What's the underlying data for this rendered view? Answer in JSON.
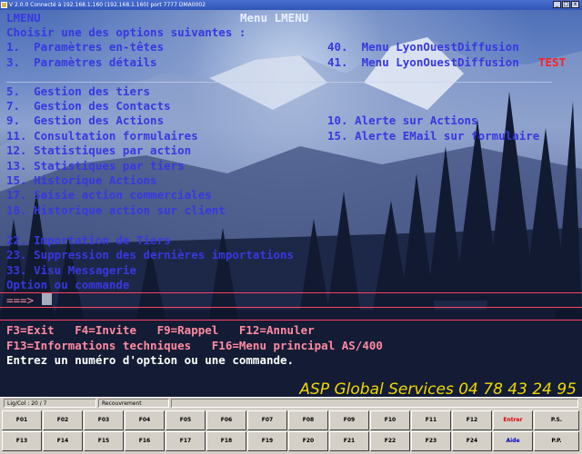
{
  "titlebar": {
    "text": "V 2.0.0 Connecté à 192.168.1.160 (192.168.1.160) port 7777  DMA0002",
    "buttons": [
      "_",
      "□",
      "x"
    ]
  },
  "terminal": {
    "screen_id": "LMENU",
    "title": "Menu LMENU",
    "prompt": "Choisir une des options suivantes :",
    "options_left": [
      "1.  Paramètres en-têtes",
      "3.  Paramètres détails",
      "5.  Gestion des tiers",
      "7.  Gestion des Contacts",
      "9.  Gestion des Actions",
      "11. Consultation formulaires",
      "12. Statistiques par action",
      "13. Statistiques par tiers",
      "15. Historique Actions",
      "17. Saisie action commerciales",
      "18. Historique action sur client",
      "22. Importation de Tiers",
      "23. Suppression des dernières importations",
      "33. Visu Messagerie"
    ],
    "options_right": [
      "40.  Menu LyonOuestDiffusion",
      "41.  Menu LyonOuestDiffusion",
      "10. Alerte sur Actions",
      "15. Alerte EMail sur formulaire"
    ],
    "test_label": "TEST",
    "input_label": "Option ou commande",
    "input_prompt": "===>",
    "input_value": "",
    "fkeys_line1": "F3=Exit   F4=Invite   F9=Rappel   F12=Annuler",
    "fkeys_line2": "F13=Informations techniques   F16=Menu principal AS/400",
    "message": "Entrez un numéro d'option ou une commande.",
    "banner": "ASP Global Services  04 78 43 24 95"
  },
  "statusbar": {
    "position_label": "Lig/Col : 20 / 7",
    "mode": "Recouvrement"
  },
  "fkey_row1": [
    "F01",
    "F02",
    "F03",
    "F04",
    "F05",
    "F06",
    "F07",
    "F08",
    "F09",
    "F10",
    "F11",
    "F12",
    "Entrer",
    "P.S."
  ],
  "fkey_row2": [
    "F13",
    "F14",
    "F15",
    "F16",
    "F17",
    "F18",
    "F19",
    "F20",
    "F21",
    "F22",
    "F23",
    "F24",
    "Aide",
    "P.P."
  ],
  "colors": {
    "terminal_text": "#3838e0",
    "title_text": "#e8f0ff",
    "message_text": "#ffffff",
    "test_text": "#ff2020",
    "enter_key": "#e00000",
    "help_key": "#0000c0",
    "banner": "#f2d800"
  }
}
